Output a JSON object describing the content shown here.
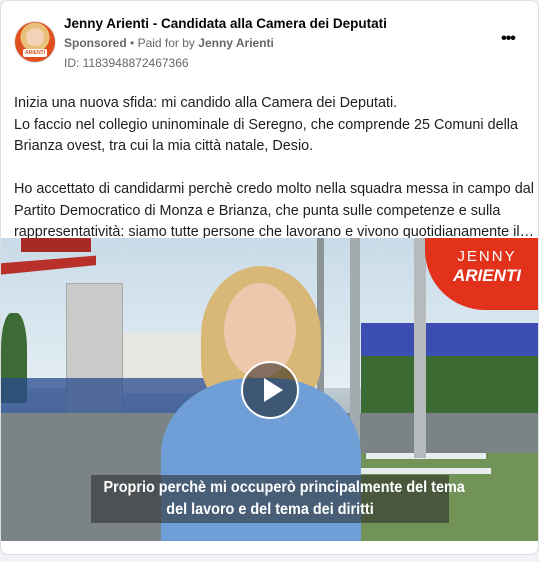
{
  "post": {
    "page_name": "Jenny Arienti - Candidata alla Camera dei Deputati",
    "sponsored": "Sponsored",
    "separator": "•",
    "paid_for_by_prefix": "Paid for by",
    "paid_for_by_name": "Jenny Arienti",
    "ad_id": "ID: 1183948872467366",
    "more_icon": "more-horizontal-icon",
    "body_lines": [
      "Inizia una nuova sfida: mi candido alla Camera dei Deputati.",
      "Lo faccio nel collegio uninominale di Seregno, che comprende 25 Comuni della",
      "Brianza ovest, tra cui la mia città natale, Desio.",
      "",
      "Ho accettato di candidarmi perchè credo molto nella squadra messa in campo dal",
      "Partito Democratico di Monza e Brianza, che punta sulle competenze e sulla",
      "rappresentatività: siamo tutte persone che lavorano e vivono quotidianamente il…"
    ]
  },
  "video": {
    "brand_line1": "JENNY",
    "brand_line2": "ARIENTI",
    "avatar_tag": "ARIENTI",
    "play_icon": "play-icon",
    "caption_line1": "Proprio perchè mi occuperò principalmente del tema",
    "caption_line2": "del lavoro e del tema dei diritti"
  },
  "colors": {
    "brand_red": "#e3321b",
    "text_secondary": "#65676b",
    "text_primary": "#050505"
  }
}
